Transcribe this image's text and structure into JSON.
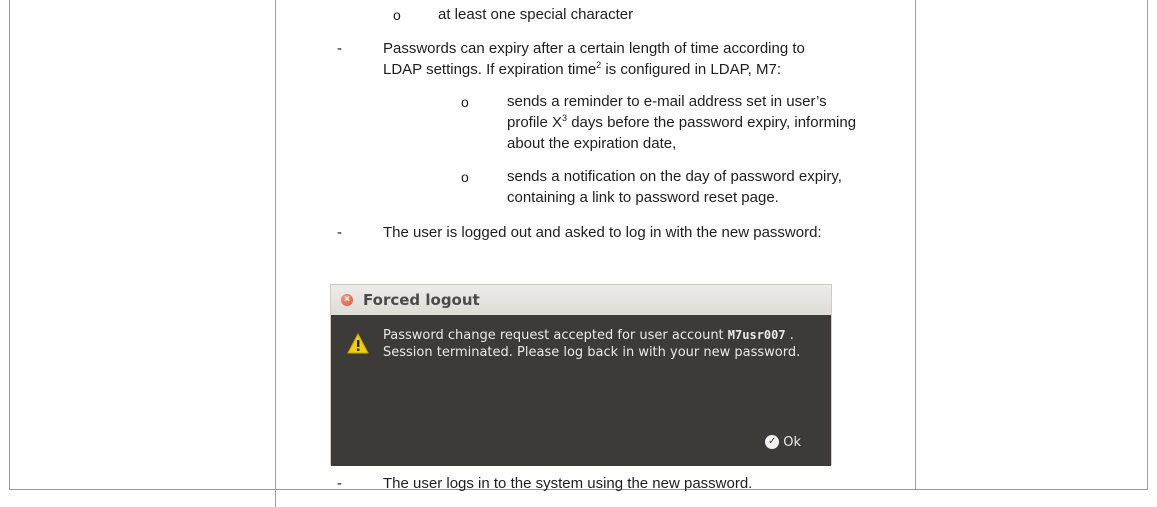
{
  "doc": {
    "line1": "at least one special character",
    "bullet1_line1": "Passwords can expiry after a certain length of time according to",
    "bullet1_line2_a": "LDAP settings. If expiration time",
    "fn2": "2",
    "bullet1_line2_b": " is configured in LDAP, M7:",
    "sub1_line1": "sends a reminder to e-mail address set in user’s",
    "sub1_line2_a": "profile X",
    "fn3": "3",
    "sub1_line2_b": " days before the password expiry, informing",
    "sub1_line3": "about the expiration date,",
    "sub2_line1": "sends a notification on the day of password expiry,",
    "sub2_line2": "containing a link to password reset page.",
    "bullet2": "The user is logged out and asked to log in with the new password:",
    "bullet3": "The user logs in to the system using the new password.",
    "dash": "-",
    "circle": "o"
  },
  "dialog": {
    "title": "Forced logout",
    "msg_a": "Password change request accepted for user account ",
    "account": "M7usr007",
    "msg_b": " . Session terminated. Please log back in with your new password.",
    "ok_label": "Ok"
  },
  "colors": {
    "dialog_body": "#3c3b37",
    "warning": "#f4d000",
    "close": "#e2522f"
  }
}
